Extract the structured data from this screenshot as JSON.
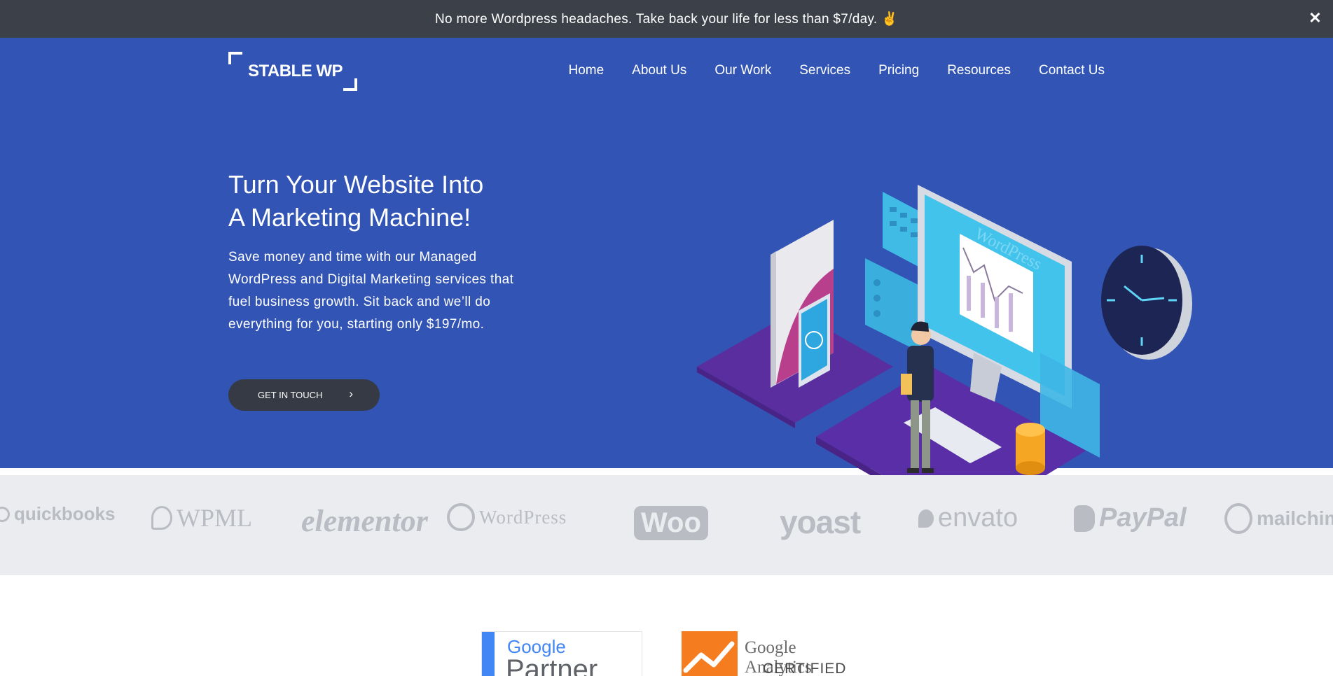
{
  "announcement": {
    "text": "No more Wordpress headaches. Take back your life for less than $7/day. ✌",
    "close": "✕"
  },
  "logo": {
    "text": "STABLE WP"
  },
  "nav": [
    "Home",
    "About Us",
    "Our Work",
    "Services",
    "Pricing",
    "Resources",
    "Contact Us"
  ],
  "hero": {
    "title_line1": "Turn Your Website Into",
    "title_line2": "A Marketing Machine!",
    "subtitle": "Save money and time with our Managed WordPress and Digital Marketing services that fuel business growth. Sit back and we’ll do everything for you, starting only $197/mo.",
    "cta": "GET IN TOUCH",
    "cta_icon": "chevron-right-icon",
    "illustration_text": "WordPress"
  },
  "brands": [
    "quickbooks",
    "WPML",
    "elementor",
    "WordPress",
    "Woo",
    "yoast",
    "envato",
    "PayPal",
    "mailchimp"
  ],
  "badges": {
    "google_partner": {
      "brand": "Google",
      "label": "Partner"
    },
    "google_analytics": {
      "brand": "Google Analytics",
      "label": "CERTIFIED"
    }
  },
  "colors": {
    "announce_bg": "#3c4049",
    "hero_bg": "#3254b4",
    "cta_bg": "#363a45",
    "strip_bg": "#ebecef",
    "brand_gray": "#b9bcc3"
  }
}
